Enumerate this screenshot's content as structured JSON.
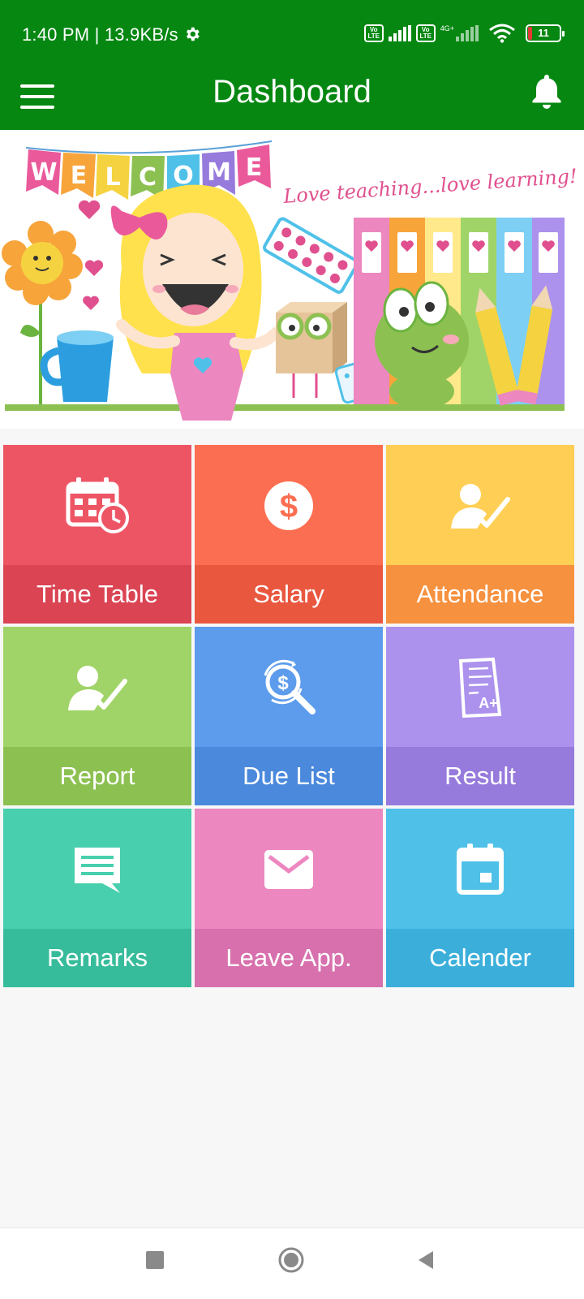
{
  "status_bar": {
    "time_speed": "1:40 PM | 13.9KB/s",
    "volte_1": "Vo LTE",
    "volte_2": "Vo LTE",
    "network": "4G+",
    "battery_level": "11"
  },
  "app_bar": {
    "title": "Dashboard"
  },
  "banner": {
    "welcome_letters": [
      "W",
      "E",
      "L",
      "C",
      "O",
      "M",
      "E"
    ],
    "tagline": "Love teaching...love learning!"
  },
  "tiles": [
    {
      "label": "Time Table",
      "icon": "calendar-clock-icon",
      "top_color": "#ed5565",
      "bottom_color": "#da4453"
    },
    {
      "label": "Salary",
      "icon": "dollar-coin-icon",
      "top_color": "#fc6e51",
      "bottom_color": "#e9573f"
    },
    {
      "label": "Attendance",
      "icon": "user-check-icon",
      "top_color": "#ffce54",
      "bottom_color": "#f6913f"
    },
    {
      "label": "Report",
      "icon": "user-check-icon",
      "top_color": "#a0d468",
      "bottom_color": "#8cc152"
    },
    {
      "label": "Due List",
      "icon": "dollar-search-icon",
      "top_color": "#5d9cec",
      "bottom_color": "#4a89dc"
    },
    {
      "label": "Result",
      "icon": "grade-paper-icon",
      "top_color": "#ac92ec",
      "bottom_color": "#967adc"
    },
    {
      "label": "Remarks",
      "icon": "chat-bubble-icon",
      "top_color": "#48cfad",
      "bottom_color": "#37bc9b"
    },
    {
      "label": "Leave App.",
      "icon": "envelope-icon",
      "top_color": "#ec87c0",
      "bottom_color": "#d770ad"
    },
    {
      "label": "Calender",
      "icon": "calendar-icon",
      "top_color": "#4fc1e9",
      "bottom_color": "#3bafda"
    }
  ],
  "colors": {
    "app_bar": "#058712",
    "background": "#f7f7f7"
  }
}
